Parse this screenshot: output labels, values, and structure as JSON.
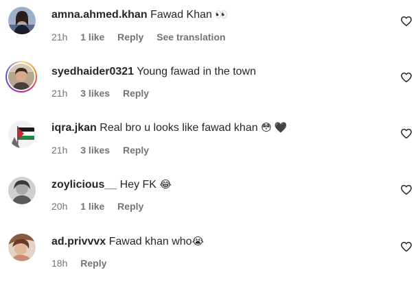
{
  "comments": [
    {
      "username": "amna.ahmed.khan",
      "text": "Fawad Khan ",
      "emoji": "👀",
      "time": "21h",
      "likes": "1 like",
      "reply": "Reply",
      "translate": "See translation"
    },
    {
      "username": "syedhaider0321",
      "text": "Young fawad in the town",
      "emoji": "",
      "time": "21h",
      "likes": "3 likes",
      "reply": "Reply"
    },
    {
      "username": "iqra.jkan",
      "text": "Real bro u looks like fawad khan",
      "emoji": "😳 🖤",
      "time": "21h",
      "likes": "3 likes",
      "reply": "Reply"
    },
    {
      "username": "zoylicious__",
      "text": "Hey FK ",
      "emoji": "😂",
      "time": "20h",
      "likes": "1 like",
      "reply": "Reply"
    },
    {
      "username": "ad.privvvx",
      "text": "Fawad khan who",
      "emoji": "😭",
      "time": "18h",
      "likes": "",
      "reply": "Reply"
    }
  ],
  "colors": {
    "text": "#262626",
    "meta": "#737373",
    "background": "#ffffff"
  },
  "icons": {
    "like": "heart-outline-icon"
  }
}
